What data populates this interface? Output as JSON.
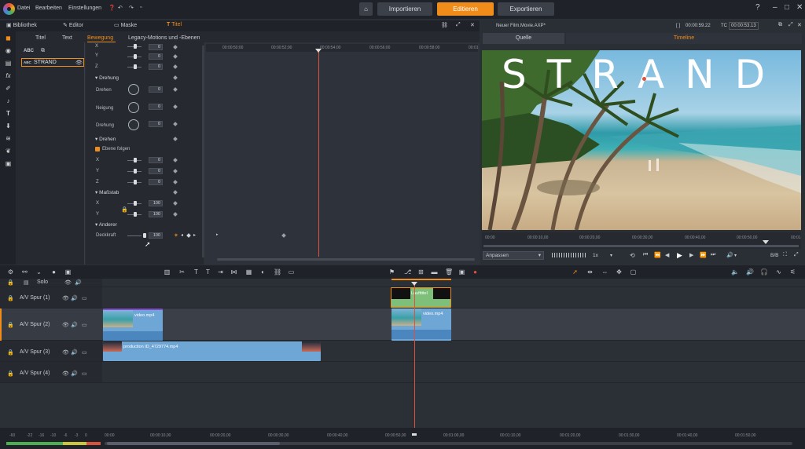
{
  "menu": {
    "items": [
      "Datei",
      "Bearbeiten",
      "Einstellungen"
    ]
  },
  "topnav": {
    "import": "Importieren",
    "edit": "Editieren",
    "export": "Exportieren"
  },
  "panel_tabs": {
    "library": "Bibliothek",
    "editor": "Editor",
    "mask": "Maske",
    "title": "Titel"
  },
  "sub_tabs": {
    "title": "Titel",
    "text": "Text",
    "motion": "Bewegung",
    "legacy": "Legacy-Motions und -Ebenen"
  },
  "objects": {
    "abc_label": "ABC",
    "item_abc": "ABC",
    "item_name": "STRAND"
  },
  "props": {
    "xyz_top": [
      {
        "label": "X",
        "value": "0"
      },
      {
        "label": "Y",
        "value": "0"
      },
      {
        "label": "Z",
        "value": "0"
      }
    ],
    "rotation_section": "Drehung",
    "rotation_rows": [
      {
        "label": "Drehen",
        "value": "0"
      },
      {
        "label": "Neigung",
        "value": "0"
      },
      {
        "label": "Drehung",
        "value": "0"
      }
    ],
    "spin_section": "Drehen",
    "follow_layer": "Ebene folgen",
    "spin_rows": [
      {
        "label": "X",
        "value": "0"
      },
      {
        "label": "Y",
        "value": "0"
      },
      {
        "label": "Z",
        "value": "0"
      }
    ],
    "scale_section": "Maßstab",
    "scale_rows": [
      {
        "label": "X",
        "value": "100"
      },
      {
        "label": "Y",
        "value": "100"
      }
    ],
    "other_section": "Anderer",
    "opacity_label": "Deckkraft",
    "opacity_value": "100"
  },
  "kf_ruler": [
    "00:00:50;00",
    "00:00:52;00",
    "00:00:54;00",
    "00:00:56;00",
    "00:00:58;00",
    "00:01"
  ],
  "preview": {
    "project": "Neuer Film.Movie.AXP*",
    "dur_label": "[ ]",
    "duration": "00:00:59.22",
    "tc_label": "TC",
    "timecode": "00:00:53.13",
    "tab_source": "Quelle",
    "tab_timeline": "Timeline",
    "overlay_text": "STRAND",
    "ruler": [
      "00:00",
      "00:00:10,00",
      "00:00:20,00",
      "00:00:30,00",
      "00:00:40,00",
      "00:00:50,00",
      "00:01"
    ],
    "fit": "Anpassen",
    "speed": "1x",
    "quality": "B/B"
  },
  "tracks": {
    "solo": "Solo",
    "rows": [
      {
        "name": "A/V Spur (1)"
      },
      {
        "name": "A/V Spur (2)"
      },
      {
        "name": "A/V Spur (3)"
      },
      {
        "name": "A/V Spur (4)"
      }
    ],
    "clips": {
      "title_clip": "Laufttitel",
      "video1": "video.mp4",
      "video2": "video.mp4",
      "production": "production ID_4729774.mp4"
    }
  },
  "bottom_ruler": [
    "00:00",
    "00:00:10,00",
    "00:00:20,00",
    "00:00:30,00",
    "00:00:40,00",
    "00:00:50,00",
    "00:01:00,00",
    "00:01:10,00",
    "00:01:20,00",
    "00:01:30,00",
    "00:01:40,00",
    "00:01:50,00"
  ],
  "meter": [
    "-60",
    "-22",
    "-16",
    "-10",
    "-6",
    "-3",
    "0"
  ],
  "colors": {
    "accent": "#f08c1a",
    "playhead": "#e0503a",
    "clip_blue": "#6ea6d6",
    "clip_green": "#7ec07a"
  }
}
